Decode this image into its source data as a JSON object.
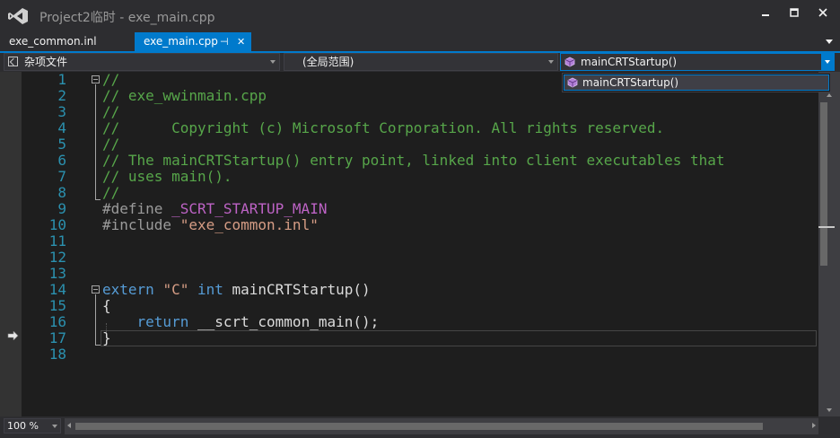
{
  "window": {
    "title": "Project2临时 - exe_main.cpp",
    "app_icon": "visual-studio-logo-icon",
    "controls": [
      "minimize-icon",
      "maximize-icon",
      "close-icon"
    ]
  },
  "tabs": [
    {
      "label": "exe_common.inl",
      "active": false
    },
    {
      "label": "exe_main.cpp",
      "active": true,
      "pin_glyph": "⊣",
      "close_glyph": "✕"
    }
  ],
  "navbar": {
    "project_combo": "杂项文件",
    "scope_combo": "(全局范围)",
    "member_combo": "mainCRTStartup()"
  },
  "dropdown": {
    "items": [
      "mainCRTStartup()"
    ]
  },
  "editor": {
    "line_numbers": [
      "1",
      "2",
      "3",
      "4",
      "5",
      "6",
      "7",
      "8",
      "9",
      "10",
      "11",
      "12",
      "13",
      "14",
      "15",
      "16",
      "17",
      "18"
    ],
    "lines": [
      [
        {
          "t": "cmt",
          "s": "//"
        }
      ],
      [
        {
          "t": "cmt",
          "s": "// exe_wwinmain.cpp"
        }
      ],
      [
        {
          "t": "cmt",
          "s": "//"
        }
      ],
      [
        {
          "t": "cmt",
          "s": "//      Copyright (c) Microsoft Corporation. All rights reserved."
        }
      ],
      [
        {
          "t": "cmt",
          "s": "//"
        }
      ],
      [
        {
          "t": "cmt",
          "s": "// The mainCRTStartup() entry point, linked into client executables that"
        }
      ],
      [
        {
          "t": "cmt",
          "s": "// uses main()."
        }
      ],
      [
        {
          "t": "cmt",
          "s": "//"
        }
      ],
      [
        {
          "t": "pp",
          "s": "#define "
        },
        {
          "t": "macro",
          "s": "_SCRT_STARTUP_MAIN"
        }
      ],
      [
        {
          "t": "pp",
          "s": "#include "
        },
        {
          "t": "str",
          "s": "\"exe_common.inl\""
        }
      ],
      [],
      [],
      [],
      [
        {
          "t": "kw",
          "s": "extern "
        },
        {
          "t": "str",
          "s": "\"C\" "
        },
        {
          "t": "kw",
          "s": "int "
        },
        {
          "t": "ident",
          "s": "mainCRTStartup()"
        }
      ],
      [
        {
          "t": "ident",
          "s": "{"
        }
      ],
      [
        {
          "t": "kw",
          "s": "    return "
        },
        {
          "t": "ident",
          "s": "__scrt_common_main();"
        }
      ],
      [
        {
          "t": "ident",
          "s": "}"
        }
      ],
      []
    ],
    "current_line": 17,
    "margin_marker": "next-statement-arrow-icon"
  },
  "status": {
    "zoom": "100 %"
  },
  "colors": {
    "accent": "#007acc",
    "comment": "#57a64a",
    "keyword": "#569cd6",
    "string": "#d69d85",
    "macro": "#bd63c5",
    "line_number": "#2b91af"
  }
}
